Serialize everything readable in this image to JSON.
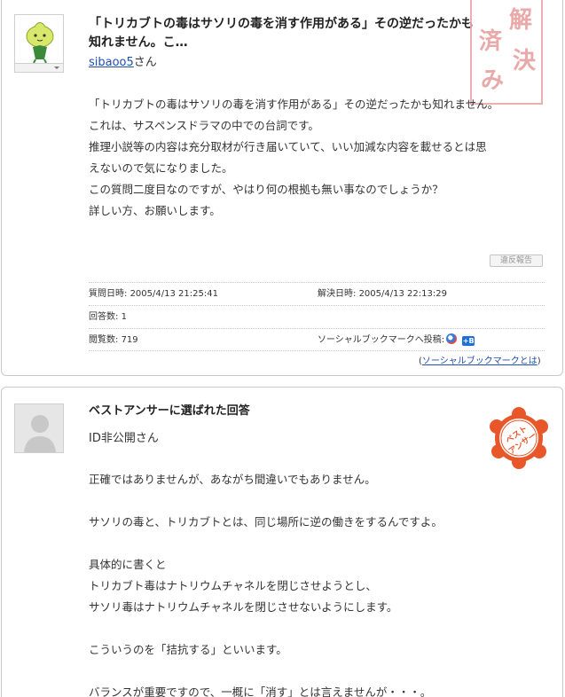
{
  "question": {
    "title_line1": "「トリカブトの毒はサソリの毒を消す作用がある」その逆だったかも",
    "title_line2": "知れません。こ…",
    "user_name": "sibaoo5",
    "user_suffix": "さん",
    "stamp_chars": [
      "解",
      "決",
      "済",
      "み"
    ],
    "body": "「トリカブトの毒はサソリの毒を消す作用がある」その逆だったかも知れません。\nこれは、サスペンスドラマの中での台詞です。\n推理小説等の内容は充分取材が行き届いていて、いい加減な内容を載せるとは思\nえないので気になりました。\nこの質問二度目なのですが、やはり何の根拠も無い事なのでしょうか？\n詳しい方、お願いします。",
    "report_label": "違反報告",
    "meta": {
      "asked_label": "質問日時:",
      "asked_value": "2005/4/13 21:25:41",
      "resolved_label": "解決日時:",
      "resolved_value": "2005/4/13 22:13:29",
      "answers_label": "回答数:",
      "answers_value": "1",
      "views_label": "閲覧数:",
      "views_value": "719",
      "social_label": "ソーシャルブックマークへ投稿:",
      "social_icon2_text": "+B",
      "social_link_open": "(",
      "social_link_text": "ソーシャルブックマークとは",
      "social_link_close": ")"
    }
  },
  "answer": {
    "heading": "ベストアンサーに選ばれた回答",
    "user": "ID非公開さん",
    "badge_line1": "ベスト",
    "badge_line2": "アンサー",
    "badge_color": "#e8572a",
    "body": "正確ではありませんが、あながち間違いでもありません。\n\nサソリの毒と、トリカブトとは、同じ場所に逆の働きをするんですよ。\n\n具体的に書くと\nトリカブト毒はナトリウムチャネルを閉じさせようとし、\nサソリ毒はナトリウムチャネルを閉じさせないようにします。\n\nこういうのを「拮抗する」といいます。\n\nバランスが重要ですので、一概に「消す」とは言えませんが・・・。"
  }
}
